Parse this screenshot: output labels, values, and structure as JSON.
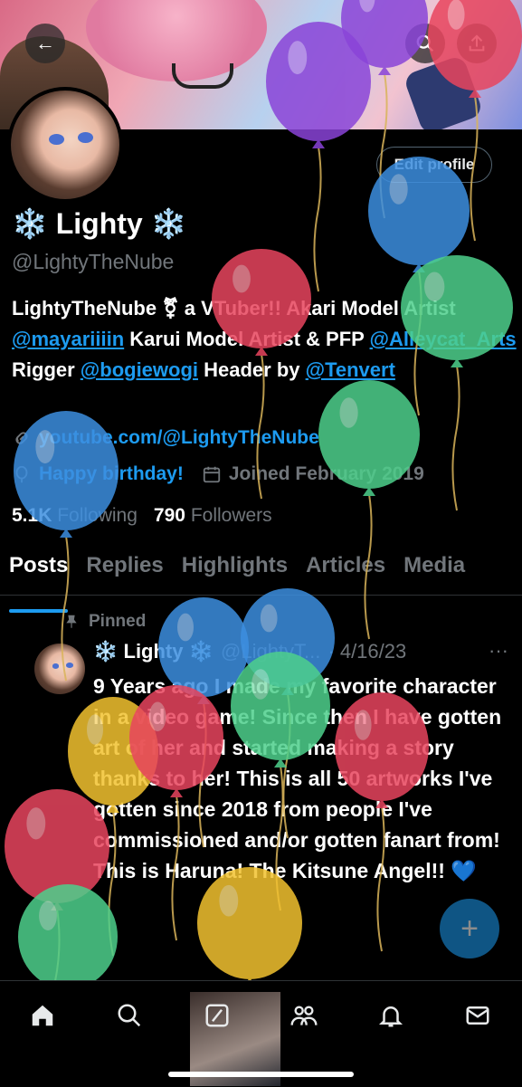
{
  "header": {
    "back_icon": "arrow-left-icon",
    "search_icon": "search-icon",
    "share_icon": "share-icon"
  },
  "profile": {
    "edit_label": "Edit profile",
    "name": "❄️ Lighty ❄️",
    "handle": "@LightyTheNube",
    "bio": {
      "p1": "LightyTheNube ⚧ a VTuber!! Akari Model Artist ",
      "m1": "@mayariiiin",
      "p2": " Karui Model Artist & PFP ",
      "m2": "@Alleycat_Arts",
      "p3": " Rigger ",
      "m3": "@bogiewogi",
      "p4": " Header by ",
      "m4": "@Tenvert"
    },
    "website": "youtube.com/@LightyTheNube",
    "birthday": "Happy birthday!",
    "joined": "Joined February 2019",
    "following_count": "5.1K",
    "following_label": "Following",
    "followers_count": "790",
    "followers_label": "Followers"
  },
  "tabs": [
    "Posts",
    "Replies",
    "Highlights",
    "Articles",
    "Media"
  ],
  "tweet": {
    "pinned_label": "Pinned",
    "author_name": "❄️ Lighty ❄️",
    "author_handle": "@LightyT...",
    "date": "· 4/16/23",
    "more": "···",
    "text": "9 Years ago I made my favorite character in a video game! Since then I have gotten art of her and started making a story thanks to her! This is all 50 artworks I've gotten since 2018 from people I've commissioned and/or gotten fanart from!\nThis is Haruna! The Kitsune Angel!! 💙"
  },
  "fab_icon": "compose-plus-icon",
  "bottom_nav": [
    "home-icon",
    "search-icon",
    "grok-icon",
    "communities-icon",
    "notifications-icon",
    "messages-icon"
  ],
  "colors": {
    "accent": "#1d9bf0",
    "muted": "#71767b",
    "background": "#000000",
    "balloon_red": "#e8455e",
    "balloon_blue": "#3d8fe0",
    "balloon_green": "#4ed08c",
    "balloon_yellow": "#f2c230",
    "balloon_purple": "#8a44d8"
  }
}
